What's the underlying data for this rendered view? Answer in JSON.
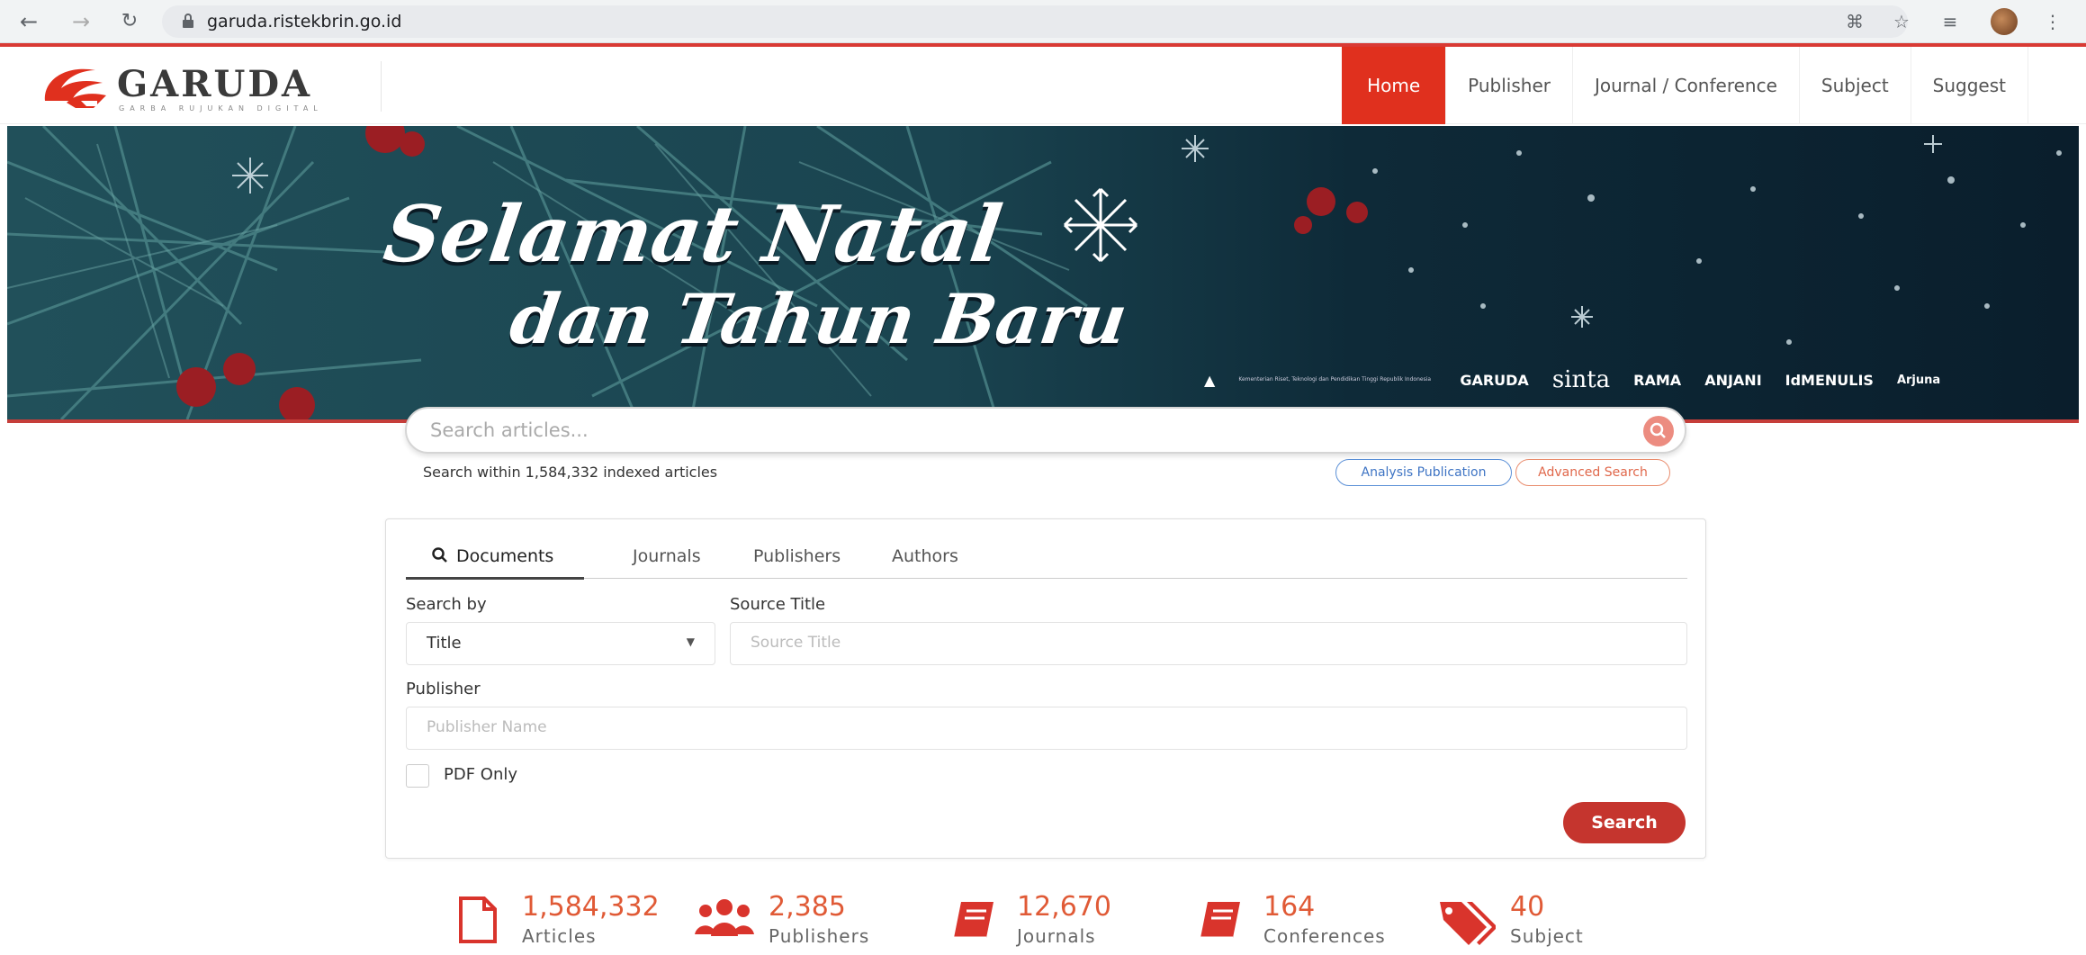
{
  "browser": {
    "url": "garuda.ristekbrin.go.id",
    "icons": [
      "back-arrow-icon",
      "forward-arrow-icon",
      "reload-icon",
      "lock-icon",
      "extensions-icon",
      "star-icon",
      "reading-list-icon",
      "profile-avatar"
    ]
  },
  "site": {
    "logo_name": "GARUDA",
    "logo_tagline": "GARBA RUJUKAN DIGITAL",
    "brand_color": "#e0301e"
  },
  "nav": {
    "home": "Home",
    "publisher": "Publisher",
    "journal": "Journal / Conference",
    "subject": "Subject",
    "suggest": "Suggest"
  },
  "banner": {
    "line1": "Selamat Natal",
    "line2": "dan Tahun Baru",
    "partner_caption": "Kementerian Riset, Teknologi dan Pendidikan Tinggi Republik Indonesia",
    "partners": [
      "GARUDA",
      "sinta",
      "RAMA",
      "ANJANI",
      "IdMENULIS",
      "Arjuna"
    ]
  },
  "search": {
    "placeholder": "Search articles...",
    "within_text": "Search within 1,584,332 indexed articles",
    "analysis_label": "Analysis Publication",
    "advanced_label": "Advanced Search"
  },
  "form": {
    "tabs": [
      "Documents",
      "Journals",
      "Publishers",
      "Authors"
    ],
    "active_tab": "Documents",
    "search_by_label": "Search by",
    "search_by_value": "Title",
    "source_title_label": "Source Title",
    "source_title_placeholder": "Source Title",
    "publisher_label": "Publisher",
    "publisher_placeholder": "Publisher Name",
    "pdf_only_label": "PDF Only",
    "pdf_only_checked": false,
    "search_button": "Search"
  },
  "stats": [
    {
      "value": "1,584,332",
      "label": "Articles",
      "icon": "document-icon"
    },
    {
      "value": "2,385",
      "label": "Publishers",
      "icon": "users-icon"
    },
    {
      "value": "12,670",
      "label": "Journals",
      "icon": "book-icon"
    },
    {
      "value": "164",
      "label": "Conferences",
      "icon": "book-icon"
    },
    {
      "value": "40",
      "label": "Subject",
      "icon": "tags-icon"
    }
  ]
}
